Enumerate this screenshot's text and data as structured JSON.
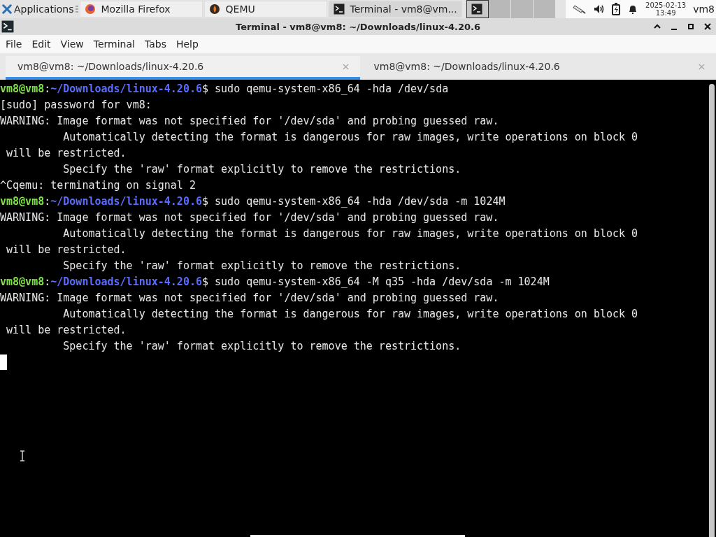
{
  "taskbar": {
    "menu": {
      "label": "Applications"
    },
    "tasks": [
      {
        "kind": "firefox",
        "label": "Mozilla Firefox",
        "selected": false
      },
      {
        "kind": "qemu",
        "label": "QEMU",
        "selected": false
      },
      {
        "kind": "terminal",
        "label": "Terminal - vm8@vm...",
        "selected": true
      }
    ],
    "workspaces": [
      {
        "selected": true
      },
      {
        "selected": false
      },
      {
        "selected": false
      },
      {
        "selected": false
      }
    ],
    "clock": {
      "date": "2025-02-13",
      "time": "13:49"
    },
    "user": "vm8"
  },
  "window": {
    "title": "Terminal - vm8@vm8: ~/Downloads/linux-4.20.6"
  },
  "menu": [
    "File",
    "Edit",
    "View",
    "Terminal",
    "Tabs",
    "Help"
  ],
  "tabs": [
    {
      "label": "vm8@vm8: ~/Downloads/linux-4.20.6",
      "selected": true
    },
    {
      "label": "vm8@vm8: ~/Downloads/linux-4.20.6",
      "selected": false
    }
  ],
  "terminal": {
    "lines": [
      {
        "kind": "prompt",
        "user": "vm8@vm8",
        "separator": ":",
        "path": "~/Downloads/linux-4.20.6",
        "command": "$ sudo qemu-system-x86_64 -hda /dev/sda"
      },
      {
        "kind": "output",
        "text": "[sudo] password for vm8:"
      },
      {
        "kind": "output",
        "text": "WARNING: Image format was not specified for '/dev/sda' and probing guessed raw."
      },
      {
        "kind": "output",
        "text": "          Automatically detecting the format is dangerous for raw images, write operations on block 0"
      },
      {
        "kind": "output",
        "text": " will be restricted."
      },
      {
        "kind": "output",
        "text": "          Specify the 'raw' format explicitly to remove the restrictions."
      },
      {
        "kind": "output",
        "text": "^Cqemu: terminating on signal 2"
      },
      {
        "kind": "prompt",
        "user": "vm8@vm8",
        "separator": ":",
        "path": "~/Downloads/linux-4.20.6",
        "command": "$ sudo qemu-system-x86_64 -hda /dev/sda -m 1024M"
      },
      {
        "kind": "output",
        "text": "WARNING: Image format was not specified for '/dev/sda' and probing guessed raw."
      },
      {
        "kind": "output",
        "text": "          Automatically detecting the format is dangerous for raw images, write operations on block 0"
      },
      {
        "kind": "output",
        "text": " will be restricted."
      },
      {
        "kind": "output",
        "text": "          Specify the 'raw' format explicitly to remove the restrictions."
      },
      {
        "kind": "prompt",
        "user": "vm8@vm8",
        "separator": ":",
        "path": "~/Downloads/linux-4.20.6",
        "command": "$ sudo qemu-system-x86_64 -M q35 -hda /dev/sda -m 1024M"
      },
      {
        "kind": "output",
        "text": "WARNING: Image format was not specified for '/dev/sda' and probing guessed raw."
      },
      {
        "kind": "output",
        "text": "          Automatically detecting the format is dangerous for raw images, write operations on block 0"
      },
      {
        "kind": "output",
        "text": " will be restricted."
      },
      {
        "kind": "output",
        "text": "          Specify the 'raw' format explicitly to remove the restrictions."
      },
      {
        "kind": "cursor"
      }
    ]
  }
}
